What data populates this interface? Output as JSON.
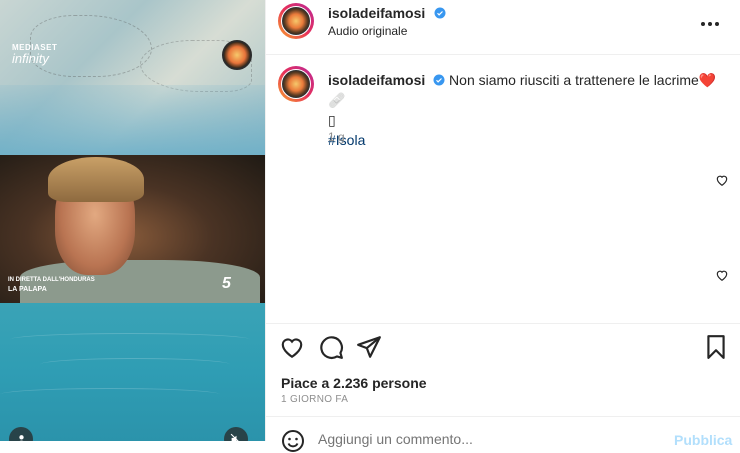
{
  "media": {
    "mediaset_line1": "MEDIASET",
    "mediaset_line2": "infinity",
    "tv_caption_line1": "IN DIRETTA DALL'HONDURAS",
    "tv_caption_line2": "LA PALAPA",
    "channel_mark": "5"
  },
  "post": {
    "username": "isoladeifamosi",
    "audio_label": "Audio originale",
    "caption_text": "Non siamo riusciti a trattenere le lacrime",
    "caption_emojis": "❤️🩹",
    "caption_extra": "▯",
    "hashtag": "#Isola",
    "time_ago": "1 g",
    "likes_text": "Piace a 2.236 persone",
    "date_text": "1 GIORNO FA"
  },
  "comment": {
    "placeholder": "Aggiungi un commento...",
    "publish_label": "Pubblica"
  },
  "icons": {
    "verified": "verified-badge-icon",
    "more": "more-options-icon",
    "like": "heart-icon",
    "comment": "comment-bubble-icon",
    "share": "paper-plane-icon",
    "save": "bookmark-icon",
    "emoji": "emoji-smile-icon",
    "user": "user-icon",
    "mute": "muted-speaker-icon"
  },
  "colors": {
    "verified": "#3897f0",
    "link": "#00376b",
    "muted_text": "#8e8e8e",
    "publish_disabled": "#b2dffc"
  }
}
